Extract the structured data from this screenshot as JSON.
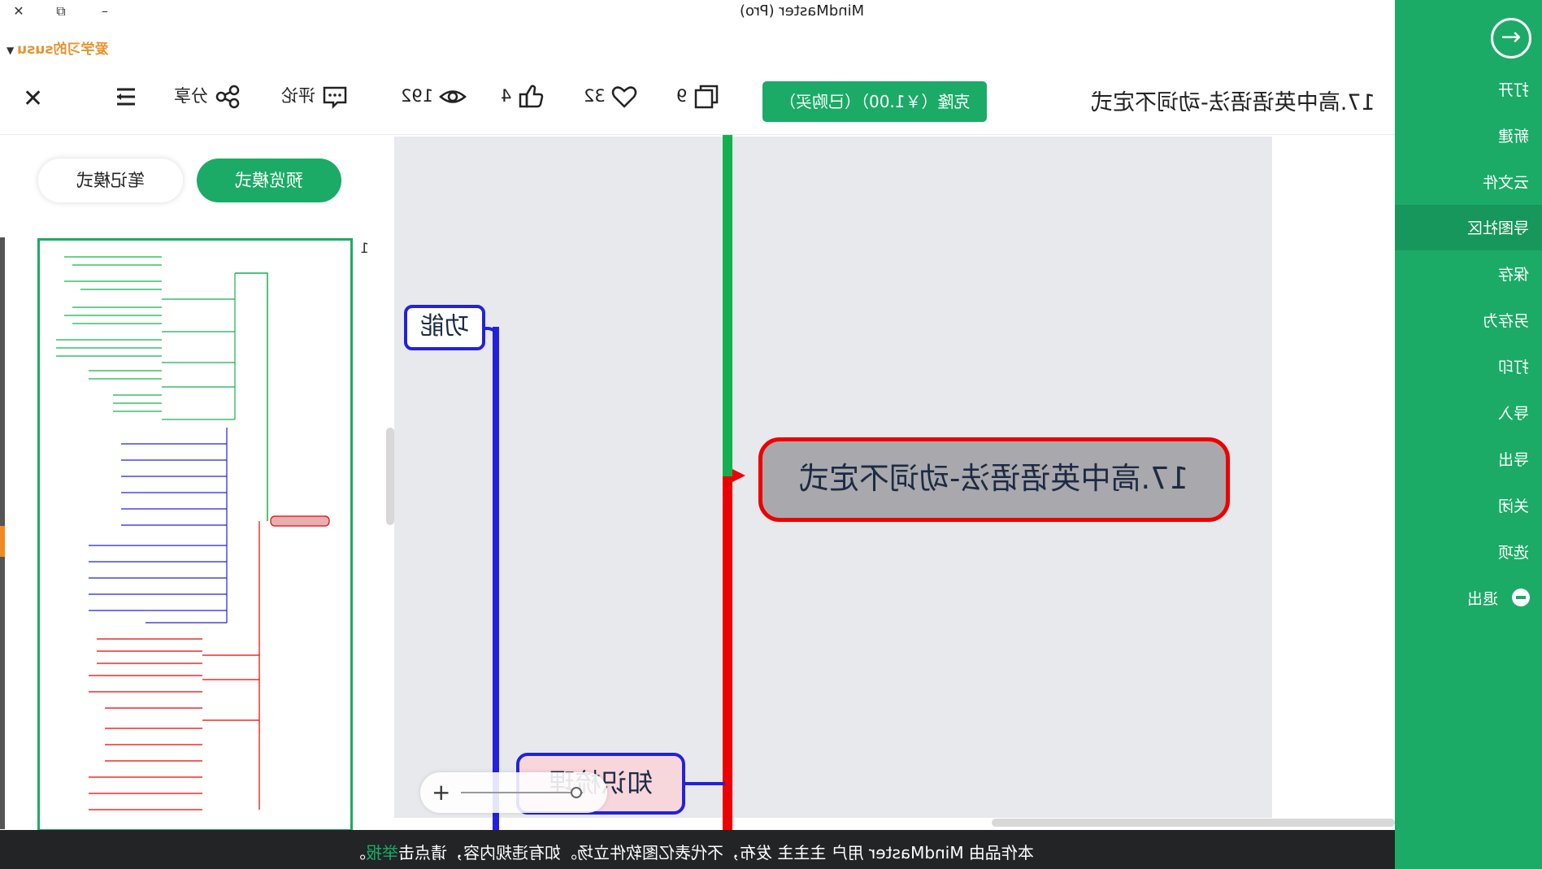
{
  "window": {
    "title": "MindMaster (Pro)",
    "controls": [
      "close-icon",
      "restore-icon",
      "minimize-icon"
    ]
  },
  "user": {
    "name": "爱学习的susu"
  },
  "toolbar": {
    "doc_title": "17.高中英语语法-动词不定式",
    "clone_label": "克隆（￥1.00）（已购买）",
    "copies_count": "9",
    "likes_favorite_count": "32",
    "thumbs_up_count": "4",
    "views_count": "192",
    "comment_label": "评论",
    "share_label": "分享"
  },
  "modes": {
    "preview": "预览模式",
    "note": "笔记模式"
  },
  "outline": {
    "page_number": "1"
  },
  "menu": {
    "items": [
      {
        "label": "打开"
      },
      {
        "label": "新建"
      },
      {
        "label": "云文件"
      },
      {
        "label": "导图社区"
      },
      {
        "label": "保存"
      },
      {
        "label": "另存为"
      },
      {
        "label": "打印"
      },
      {
        "label": "导入"
      },
      {
        "label": "导出"
      },
      {
        "label": "关闭"
      },
      {
        "label": "选项"
      },
      {
        "label": "退出"
      }
    ],
    "active_item": "导图社区"
  },
  "mindmap": {
    "central_topic": "17.高中英语语法-动词不定式",
    "branch_function": "功能",
    "branch_knowledge": "知识梳理"
  },
  "footer": {
    "notice": "本作品由 MindMaster 用户 主主主 发布，不代表亿图软件立场。如有违规内容，请点击",
    "report_link": "举报"
  },
  "colors": {
    "brand_green": "#1bab67",
    "central_border": "#ee0000",
    "central_fill": "#a9a9ad",
    "branch_blue": "#2222dd",
    "branch_green": "#14b04f"
  }
}
